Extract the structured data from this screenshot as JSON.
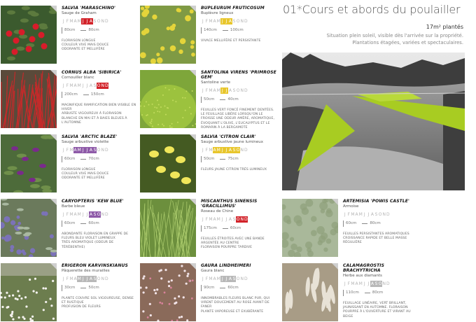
{
  "header": {
    "title": "01*Cours et abords du poulailler",
    "area": "17m² plantés",
    "subtitle_line1": "Situation plein soleil, visible dès l'arrivée sur la propriété.",
    "subtitle_line2": "Plantations étagées, variées et spectaculaires."
  },
  "month_letters": [
    "J",
    "F",
    "M",
    "A",
    "M",
    "J",
    "J",
    "A",
    "S",
    "O",
    "N",
    "D"
  ],
  "colors": {
    "red": "#d2232a",
    "yellow": "#e8c62c",
    "violet": "#8e5aa8",
    "gray": "#b8b8b8",
    "pink": "#e56aa3"
  },
  "plants": [
    {
      "name": "Salvia 'Maraschino'",
      "common": "Sauge de Graham",
      "bloom": [
        6,
        7,
        8
      ],
      "bloom_color": "#d2232a",
      "height": "80cm",
      "width": "80cm",
      "desc": [
        "Floraison longue",
        "Couleur vive mais douce",
        "Odorante et mellifère"
      ],
      "photo": "red-flower"
    },
    {
      "name": "Cornus alba 'Sibirica'",
      "common": "Cornouiller blanc",
      "bloom": [
        10,
        11,
        12
      ],
      "bloom_color": "#d2232a",
      "height": "200cm",
      "width": "150cm",
      "desc": [
        "Magnifique ramification bien visible en hiver",
        "Arbuste vigoureux à floraison blanche en mai et à baies bleues à l'automne"
      ],
      "photo": "red-stems"
    },
    {
      "name": "Salvia 'Arctic Blaze'",
      "common": "Sauge arbustive violette",
      "bloom": [
        4,
        5,
        6,
        7,
        8,
        9
      ],
      "bloom_color": "#8e5aa8",
      "height": "60cm",
      "width": "70cm",
      "desc": [
        "Floraison longue",
        "Couleur vive mais douce",
        "Odorante et mellifère"
      ],
      "photo": "purple-flower"
    },
    {
      "name": "Caryopteris 'Kew Blue'",
      "common": "Barbe bleue",
      "bloom": [
        8,
        9,
        10
      ],
      "bloom_color": "#8e5aa8",
      "height": "60cm",
      "width": "60cm",
      "desc": [
        "Abondante floraison en grappe de fleurs bleu violet lumineux",
        "Très aromatique (odeur de térébenthe)"
      ],
      "photo": "blue-flower"
    },
    {
      "name": "Erigeron karvinskianus",
      "common": "Pâquerette des murailles",
      "bloom": [
        5,
        6,
        7,
        8,
        9
      ],
      "bloom_color": "#b8b8b8",
      "height": "30cm",
      "width": "50cm",
      "desc": [
        "Plante couvre sol vigoureuse, dense et rustique",
        "Profusion de fleurs"
      ],
      "photo": "white-daisy"
    },
    {
      "name": "Bupleurum fruticosum",
      "common": "Buplèvre ligneux",
      "bloom": [
        6,
        7,
        8
      ],
      "bloom_color": "#e8c62c",
      "height": "140cm",
      "width": "100cm",
      "desc": [
        "Vivace mellifère et persistante"
      ],
      "photo": "yellow-umbel"
    },
    {
      "name": "Santolina virens 'Primrose Gem'",
      "common": "Santoline verte",
      "bloom": [
        6,
        7
      ],
      "bloom_color": "#e8c62c",
      "height": "50cm",
      "width": "40cm",
      "desc": [
        "Feuilles vert foncé finement dentées.",
        "Le feuillage libère lorsqu'on le froisse une odeur amère, aromatique, évoquant l'olive, l'eucalyptus et le romarin à la bergamote"
      ],
      "photo": "green-mound"
    },
    {
      "name": "Salvia 'Citron Clair'",
      "common": "Sauge arbustive jaune lumineux",
      "bloom": [
        4,
        5,
        6,
        7,
        8,
        9,
        10
      ],
      "bloom_color": "#e8c62c",
      "height": "50cm",
      "width": "75cm",
      "desc": [
        "Fleurs jaune citron très lumineux"
      ],
      "photo": "yellow-salvia"
    },
    {
      "name": "Miscanthus sinensis 'Gracillimus'",
      "common": "Roseau de Chine",
      "bloom": [
        10,
        11,
        12
      ],
      "bloom_color": "#d2232a",
      "height": "175cm",
      "width": "60cm",
      "desc": [
        "Feuilles étroites avec une bande argentée au centre",
        "Floraison pourpre tardive"
      ],
      "photo": "grass"
    },
    {
      "name": "Gaura lindheimeri",
      "common": "Gaura blanc",
      "bloom": [
        6,
        7,
        8,
        9
      ],
      "bloom_color": "#b8b8b8",
      "height": "90cm",
      "width": "60cm",
      "desc": [
        "Innombrables fleurs blanc pur, qui virent doucement au rose avant de faner",
        "Plante vaporeuse et exubérante"
      ],
      "photo": "gaura"
    },
    {
      "name": "Artemisia 'Powis Castle'",
      "common": "Armoise",
      "bloom": [],
      "bloom_color": "#b8b8b8",
      "height": "60cm",
      "width": "80cm",
      "desc": [
        "Feuilles persistantes aromatiques",
        "Croissance rapide et belle masse régulière"
      ],
      "photo": "artemisia"
    },
    {
      "name": "Calamagrostis brachytricha",
      "common": "Herbe aux diamants",
      "bloom": [
        8,
        9,
        10
      ],
      "bloom_color": "#b8b8b8",
      "height": "110cm",
      "width": "80cm",
      "desc": [
        "Feuillage linéaire, vert brillant, jaunissant en automne. Floraison pourpre à l'ouverture et virant au beige"
      ],
      "photo": "plumes"
    }
  ]
}
